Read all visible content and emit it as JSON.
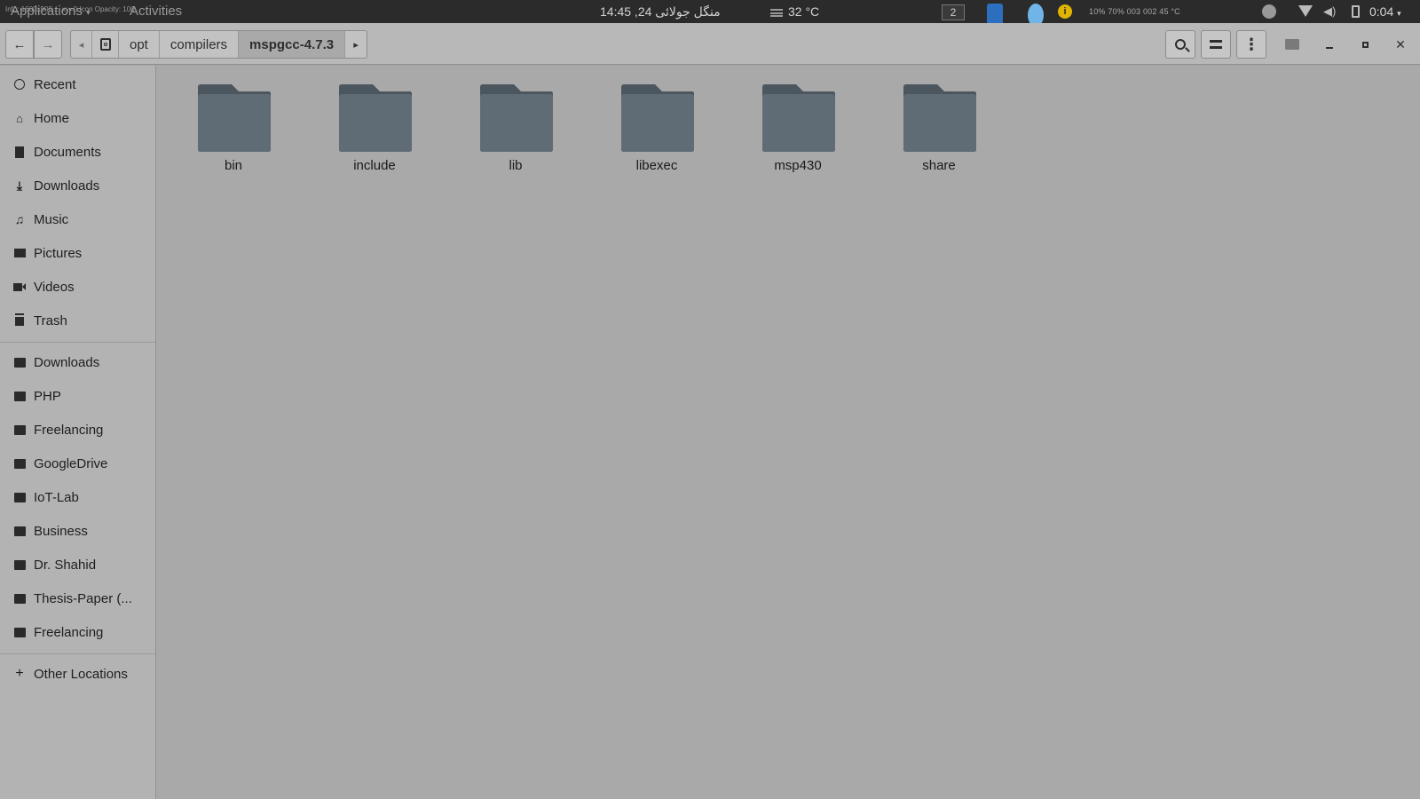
{
  "top_panel": {
    "info_text": "Info: 1600x900 ... xy=0 Icon Opacity: 100",
    "applications": "Applications",
    "activities": "Activities",
    "clock": "منگل جولائی 24, 14:45",
    "weather": "32 °C",
    "workspace": "2",
    "stats": "10%  70%  003  002  45 °C",
    "time": "0:04"
  },
  "header": {
    "back": "←",
    "forward": "→",
    "crumb_left": "◂",
    "crumb_right": "▸",
    "breadcrumbs": [
      "opt",
      "compilers",
      "mspgcc-4.7.3"
    ]
  },
  "sidebar": {
    "places": [
      "Recent",
      "Home",
      "Documents",
      "Downloads",
      "Music",
      "Pictures",
      "Videos",
      "Trash"
    ],
    "bookmarks": [
      "Downloads",
      "PHP",
      "Freelancing",
      "GoogleDrive",
      "IoT-Lab",
      "Business",
      "Dr. Shahid",
      "Thesis-Paper (...",
      "Freelancing"
    ],
    "other": "Other Locations"
  },
  "files": [
    "bin",
    "include",
    "lib",
    "libexec",
    "msp430",
    "share"
  ],
  "colors": {
    "folder_body": "#5f6b75",
    "folder_tab": "#4b565f",
    "background": "#a9a9a9"
  }
}
